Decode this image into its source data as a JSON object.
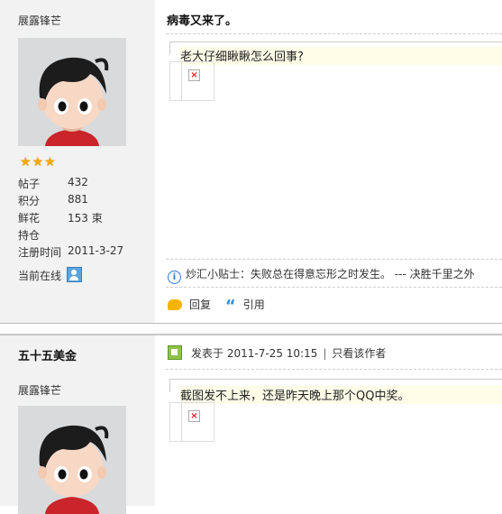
{
  "post1": {
    "author_rank": "展露锋芒",
    "avatar_icon": "cartoon-avatar",
    "stars": [
      "★",
      "★",
      "★"
    ],
    "stats": [
      {
        "label": "帖子",
        "value": "432"
      },
      {
        "label": "积分",
        "value": "881"
      },
      {
        "label": "鲜花",
        "value": "153 束"
      },
      {
        "label": "持仓",
        "value": ""
      },
      {
        "label": "注册时间",
        "value": "2011-3-27"
      }
    ],
    "online_label": "当前在线",
    "title": "病毒又来了。",
    "message": "老大仔细瞅瞅怎么回事?",
    "tip": "炒汇小贴士：失败总在得意忘形之时发生。 --- 决胜千里之外",
    "reply_label": "回复",
    "quote_label": "引用"
  },
  "post2": {
    "author_name": "五十五美金",
    "author_rank": "展露锋芒",
    "avatar_icon": "cartoon-avatar",
    "posted_label": "发表于",
    "posted_time": "2011-7-25 10:15",
    "separator": "|",
    "only_author_label": "只看该作者",
    "message": "截图发不上来，还是昨天晚上那个QQ中奖。"
  }
}
